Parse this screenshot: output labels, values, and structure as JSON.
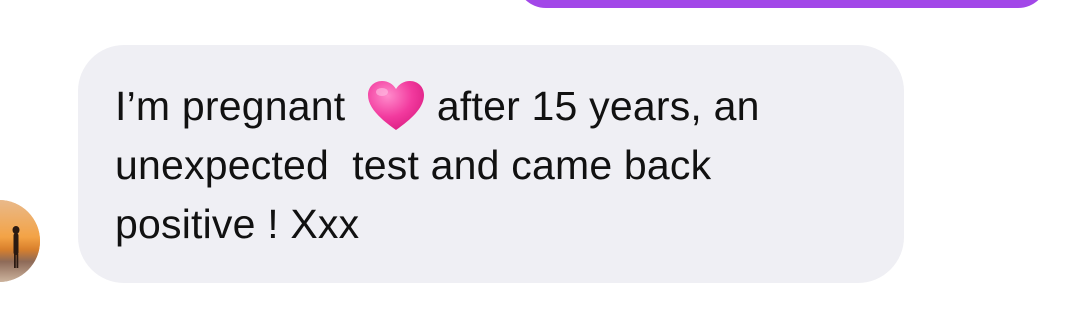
{
  "conversation": {
    "sent_message_partial": {
      "color": "#a247e8"
    },
    "received_message": {
      "before_emoji": "I’m pregnant ",
      "emoji": "heart-icon",
      "line1_after_emoji": "after 15 years, an",
      "line2": "unexpected  test and came back",
      "line3": "positive ! Xxx",
      "bubble_color": "#efeff4",
      "emoji_color": "#f0359a"
    },
    "sender_avatar": "avatar"
  }
}
